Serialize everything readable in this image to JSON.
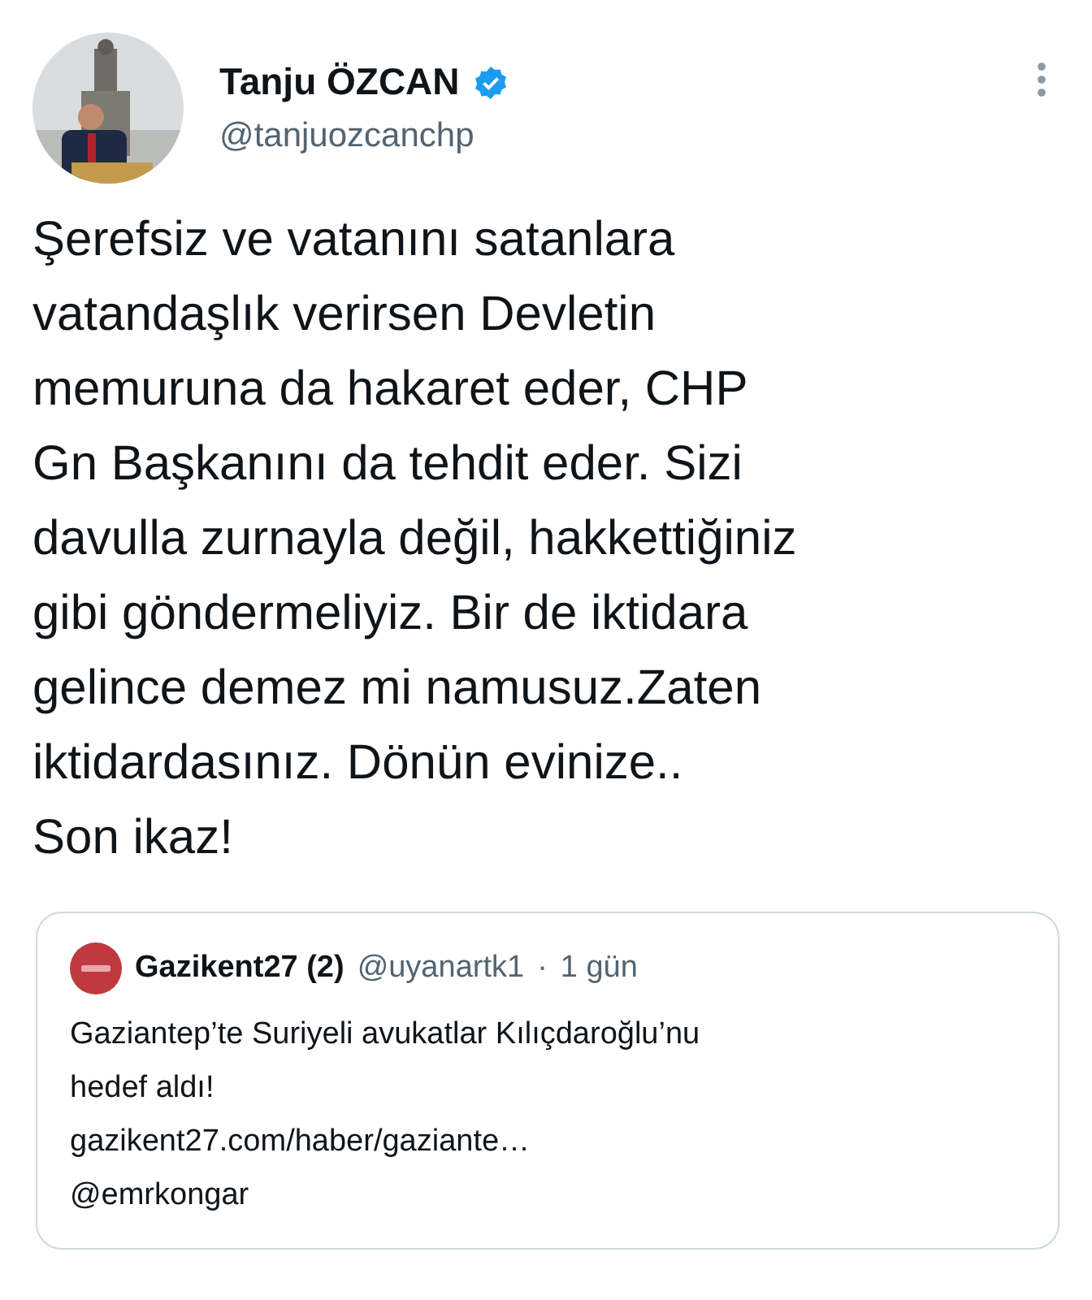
{
  "author": {
    "name": "Tanju ÖZCAN",
    "verified": true,
    "handle": "@tanjuozcanchp"
  },
  "body_lines": [
    "Şerefsiz ve vatanını satanlara",
    "vatandaşlık verirsen Devletin",
    "memuruna da hakaret eder, CHP",
    "Gn Başkanını da tehdit eder. Sizi",
    "davulla zurnayla değil, hakkettiğiniz",
    "gibi göndermeliyiz. Bir de iktidara",
    "gelince demez mi namusuz.Zaten",
    "iktidardasınız. Dönün evinize..",
    "Son ikaz!"
  ],
  "quoted": {
    "name": "Gazikent27 (2)",
    "handle": "@uyanartk1",
    "separator": "·",
    "time": "1 gün",
    "body_lines": [
      "Gaziantep’te Suriyeli avukatlar Kılıçdaroğlu’nu",
      "hedef aldı!",
      "gazikent27.com/haber/gaziante…",
      "@emrkongar"
    ]
  }
}
